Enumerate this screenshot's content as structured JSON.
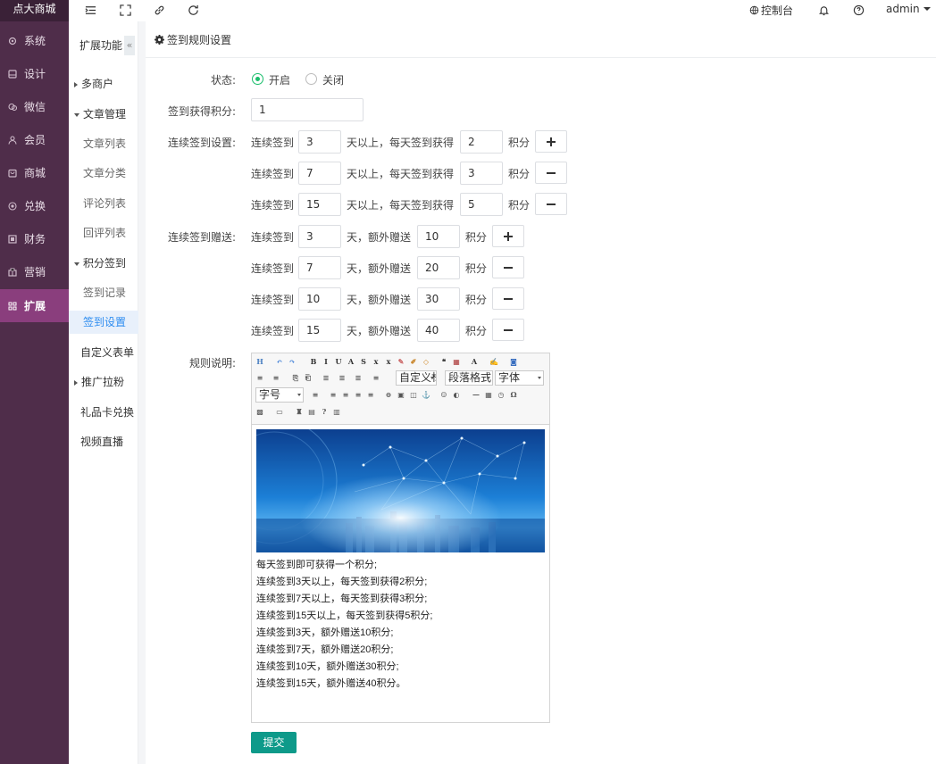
{
  "brand": "点大商城",
  "left_nav": [
    {
      "label": "系统",
      "icon": "gear-icon"
    },
    {
      "label": "设计",
      "icon": "design-icon"
    },
    {
      "label": "微信",
      "icon": "wechat-icon"
    },
    {
      "label": "会员",
      "icon": "user-icon"
    },
    {
      "label": "商城",
      "icon": "shop-icon"
    },
    {
      "label": "兑换",
      "icon": "exchange-icon"
    },
    {
      "label": "财务",
      "icon": "finance-icon"
    },
    {
      "label": "营销",
      "icon": "marketing-icon"
    },
    {
      "label": "扩展",
      "icon": "extend-icon",
      "active": true
    }
  ],
  "topbar": {
    "console": "控制台",
    "user": "admin",
    "icons": [
      "menu-toggle-icon",
      "fullscreen-icon",
      "link-icon",
      "refresh-icon",
      "globe-icon",
      "bell-icon",
      "help-icon",
      "caret-down-icon"
    ]
  },
  "sec_nav": {
    "title": "扩展功能",
    "collapse": "«",
    "items": [
      {
        "label": "多商户",
        "type": "group",
        "expanded": false
      },
      {
        "label": "文章管理",
        "type": "group",
        "expanded": true
      },
      {
        "label": "文章列表",
        "type": "sub"
      },
      {
        "label": "文章分类",
        "type": "sub"
      },
      {
        "label": "评论列表",
        "type": "sub"
      },
      {
        "label": "回评列表",
        "type": "sub"
      },
      {
        "label": "积分签到",
        "type": "group",
        "expanded": true
      },
      {
        "label": "签到记录",
        "type": "sub"
      },
      {
        "label": "签到设置",
        "type": "sub",
        "active": true
      },
      {
        "label": "自定义表单",
        "type": "plain"
      },
      {
        "label": "推广拉粉",
        "type": "group",
        "expanded": false
      },
      {
        "label": "礼品卡兑换",
        "type": "plain"
      },
      {
        "label": "视频直播",
        "type": "plain"
      }
    ]
  },
  "form": {
    "title": "签到规则设置",
    "status_label": "状态:",
    "status_on": "开启",
    "status_off": "关闭",
    "status_value": "on",
    "points_label": "签到获得积分:",
    "points_value": "1",
    "continuous_label": "连续签到设置:",
    "continuous_rows": [
      {
        "prefix": "连续签到",
        "days": "3",
        "mid": "天以上，每天签到获得",
        "points": "2",
        "suffix": "积分",
        "action": "add"
      },
      {
        "prefix": "连续签到",
        "days": "7",
        "mid": "天以上，每天签到获得",
        "points": "3",
        "suffix": "积分",
        "action": "remove"
      },
      {
        "prefix": "连续签到",
        "days": "15",
        "mid": "天以上，每天签到获得",
        "points": "5",
        "suffix": "积分",
        "action": "remove"
      }
    ],
    "bonus_label": "连续签到赠送:",
    "bonus_rows": [
      {
        "prefix": "连续签到",
        "days": "3",
        "mid": "天，额外赠送",
        "points": "10",
        "suffix": "积分",
        "action": "add"
      },
      {
        "prefix": "连续签到",
        "days": "7",
        "mid": "天，额外赠送",
        "points": "20",
        "suffix": "积分",
        "action": "remove"
      },
      {
        "prefix": "连续签到",
        "days": "10",
        "mid": "天，额外赠送",
        "points": "30",
        "suffix": "积分",
        "action": "remove"
      },
      {
        "prefix": "连续签到",
        "days": "15",
        "mid": "天，额外赠送",
        "points": "40",
        "suffix": "积分",
        "action": "remove"
      }
    ],
    "rules_label": "规则说明:",
    "editor": {
      "selects": {
        "custom": "自定义标",
        "paragraph": "段落格式",
        "font": "字体",
        "size": "字号"
      },
      "content_lines": [
        "每天签到即可获得一个积分;",
        "连续签到3天以上，每天签到获得2积分;",
        "连续签到7天以上，每天签到获得3积分;",
        "连续签到15天以上，每天签到获得5积分;",
        "连续签到3天，额外赠送10积分;",
        "连续签到7天，额外赠送20积分;",
        "连续签到10天，额外赠送30积分;",
        "连续签到15天，额外赠送40积分。"
      ]
    },
    "submit": "提交"
  }
}
